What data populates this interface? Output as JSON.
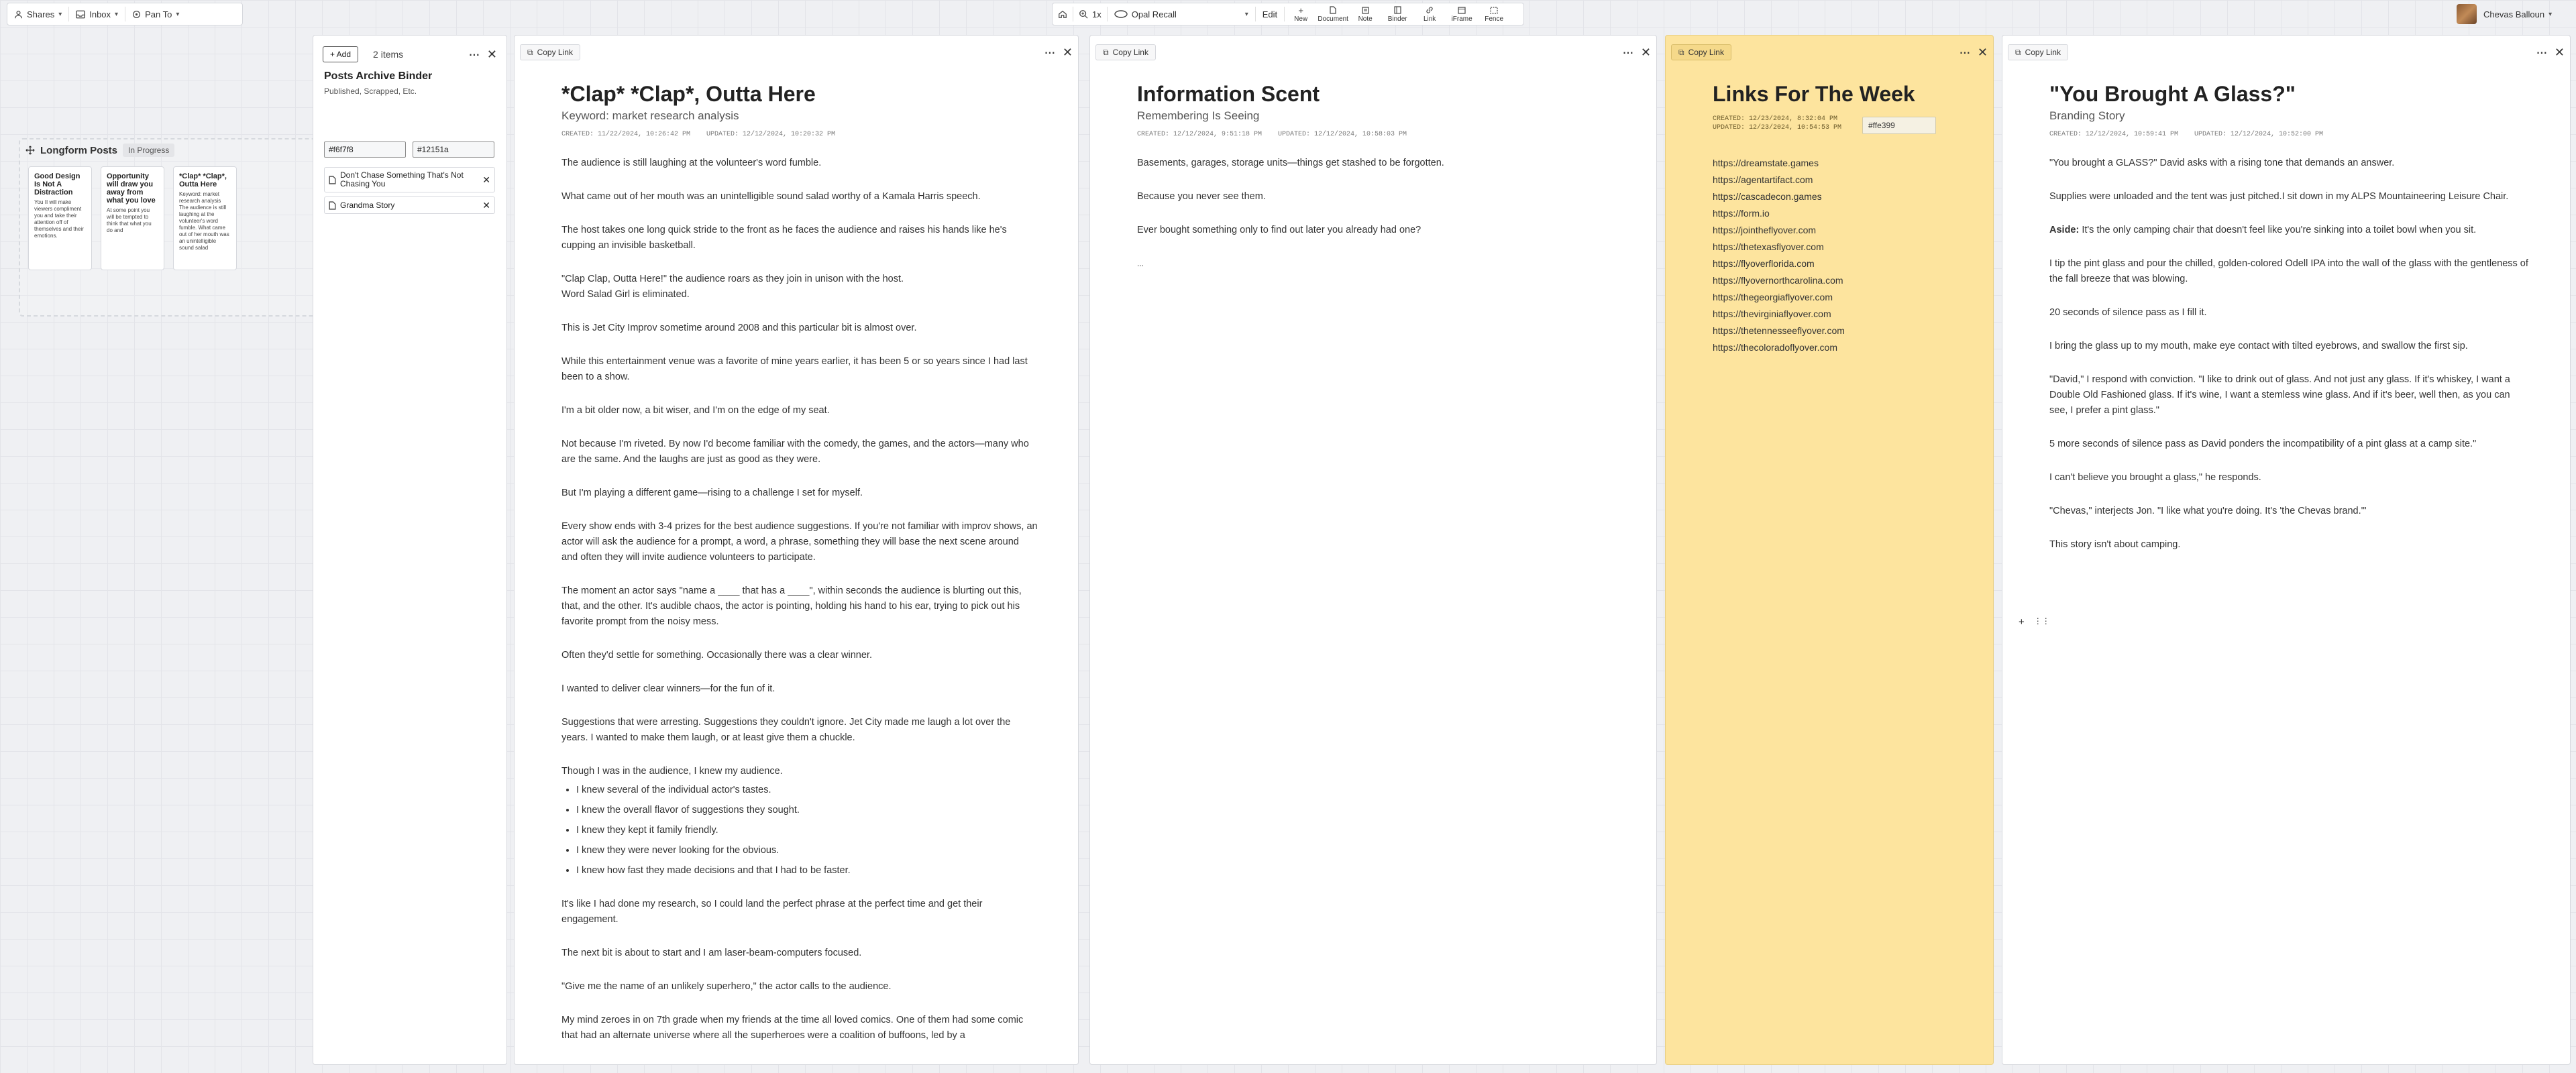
{
  "toolbar_left": {
    "shares": "Shares",
    "inbox": "Inbox",
    "pan_to": "Pan To"
  },
  "toolbar_center": {
    "zoom": "1x",
    "workspace": "Opal Recall",
    "edit": "Edit",
    "tools": [
      "New",
      "Document",
      "Note",
      "Binder",
      "Link",
      "iFrame",
      "Fence"
    ]
  },
  "user": {
    "name": "Chevas Balloun"
  },
  "canvas_group": {
    "title": "Longform Posts",
    "badge": "In Progress",
    "cards": [
      {
        "title": "Good Design Is Not A Distraction",
        "body": "You II will make viewers compliment you and take their attention off of themselves and their emotions."
      },
      {
        "title": "Opportunity will draw you away from what you love",
        "body": "At some point you will be tempted to think that what you do and"
      },
      {
        "title": "*Clap* *Clap*, Outta Here",
        "body": "Keyword: market research analysis The audience is still laughing at the volunteer's word fumble. What came out of her mouth was an unintelligible sound salad"
      }
    ]
  },
  "binder": {
    "add_label": "+ Add",
    "items_count": "2 items",
    "title": "Posts Archive Binder",
    "subtitle": "Published, Scrapped, Etc.",
    "color1": "#f6f7f8",
    "color2": "#12151a",
    "items": [
      "Don't Chase Something That's Not Chasing You",
      "Grandma Story"
    ]
  },
  "copy_link": "Copy Link",
  "doc1": {
    "title": "*Clap* *Clap*, Outta Here",
    "subtitle": "Keyword: market research analysis",
    "created": "CREATED: 11/22/2024, 10:26:42 PM",
    "updated": "UPDATED: 12/12/2024, 10:20:32 PM",
    "paragraphs": [
      "The audience is still laughing at the volunteer's word fumble.",
      "What came out of her mouth was an unintelligible sound salad worthy of a Kamala Harris speech.",
      "The host takes one long quick stride to the front as he faces the audience and raises his hands like he's cupping an invisible basketball.",
      "\"Clap Clap, Outta Here!\" the audience roars as they join in unison with the host.\nWord Salad Girl is eliminated.",
      "This is Jet City Improv sometime around 2008 and this particular bit is almost over.",
      "While this entertainment venue was a favorite of mine years earlier, it has been 5 or so years since I had last been to a show.",
      "I'm a bit older now, a bit wiser, and I'm on the edge of my seat.",
      "Not because I'm riveted. By now I'd become familiar with the comedy, the games, and the actors—many who are the same. And the laughs are just as good as they were.",
      "But I'm playing a different game—rising to a challenge I set for myself.",
      "Every show ends with 3-4 prizes for the best audience suggestions. If you're not familiar with improv shows, an actor will ask the audience for a prompt, a word, a phrase, something they will base the next scene around and often they will invite audience volunteers to participate.",
      "The moment an actor says \"name a ____ that has a ____\", within seconds the audience is blurting out this, that, and the other. It's audible chaos, the actor is pointing, holding his hand to his ear, trying to pick out his favorite prompt from the noisy mess.",
      "Often they'd settle for something. Occasionally there was a clear winner.",
      "I wanted to deliver clear winners—for the fun of it.",
      "Suggestions that were arresting. Suggestions they couldn't ignore. Jet City made me laugh a lot over the years. I wanted to make them laugh, or at least give them a chuckle.",
      "Though I was in the audience, I knew my audience."
    ],
    "bullets": [
      "I knew several of the individual actor's tastes.",
      "I knew the overall flavor of suggestions they sought.",
      "I knew they kept it family friendly.",
      "I knew they were never looking for the obvious.",
      "I knew how fast they made decisions and that I had to be faster."
    ],
    "paragraphs_after": [
      "It's like I had done my research, so I could land the perfect phrase at the perfect time and get their engagement.",
      "The next bit is about to start and I am laser-beam-computers focused.",
      "\"Give me the name of an unlikely superhero,\" the actor calls to the audience.",
      "My mind zeroes in on 7th grade when my friends at the time all loved comics. One of them had some comic that had an alternate universe where all the superheroes were a coalition of buffoons, led by a"
    ]
  },
  "doc2": {
    "title": "Information Scent",
    "subtitle": "Remembering Is Seeing",
    "created": "CREATED: 12/12/2024, 9:51:18 PM",
    "updated": "UPDATED: 12/12/2024, 10:58:03 PM",
    "paragraphs": [
      "Basements, garages, storage units—things get stashed to be forgotten.",
      "Because you never see them.",
      "Ever bought something only to find out later you already had one?",
      "..."
    ]
  },
  "links_note": {
    "title": "Links For The Week",
    "created": "CREATED: 12/23/2024, 8:32:04 PM",
    "updated": "UPDATED: 12/23/2024, 10:54:53 PM",
    "color_value": "#ffe399",
    "bg_color": "#fde49e",
    "links": [
      "https://dreamstate.games",
      "https://agentartifact.com",
      "https://cascadecon.games",
      "https://form.io",
      "https://jointheflyover.com",
      "https://thetexasflyover.com",
      "https://flyoverflorida.com",
      "https://flyovernorthcarolina.com",
      "https://thegeorgiaflyover.com",
      "https://thevirginiaflyover.com",
      "https://thetennesseeflyover.com",
      "https://thecoloradoflyover.com"
    ]
  },
  "doc3": {
    "title": "\"You Brought A Glass?\"",
    "subtitle": "Branding Story",
    "created": "CREATED: 12/12/2024, 10:59:41 PM",
    "updated": "UPDATED: 12/12/2024, 10:52:00 PM",
    "p1": "\"You brought a GLASS?\" David asks with a rising tone that demands an answer.",
    "p2": "Supplies were unloaded and the tent was just pitched.I sit down in my ALPS Mountaineering Leisure Chair.",
    "aside_label": "Aside:",
    "aside_text": " It's the only camping chair that doesn't feel like you're sinking into a toilet bowl when you sit.",
    "paragraphs": [
      "I tip the pint glass and pour the chilled, golden-colored Odell IPA into the wall of the glass with the gentleness of the fall breeze that was blowing.",
      "20 seconds of silence pass as I fill it.",
      "I bring the glass up to my mouth, make eye contact with tilted eyebrows, and swallow the first sip.",
      "\"David,\" I respond with conviction. \"I like to drink out of glass. And not just any glass. If it's whiskey, I want a Double Old Fashioned glass. If it's wine, I want a stemless wine glass. And if it's beer, well then, as you can see, I prefer a pint glass.\"",
      "5 more seconds of silence pass as David ponders the incompatibility of a pint glass at a camp site.\"",
      "I can't believe you brought a glass,\" he responds.",
      "\"Chevas,\" interjects Jon. \"I like what you're doing. It's 'the Chevas brand.'\"",
      "This story isn't about camping."
    ]
  }
}
